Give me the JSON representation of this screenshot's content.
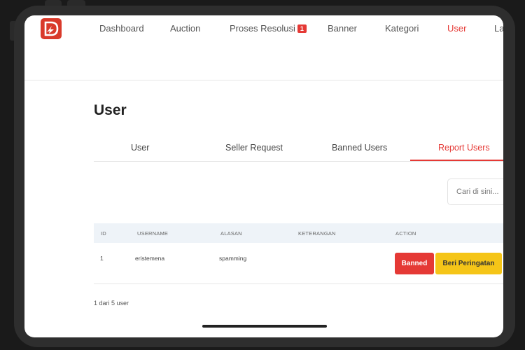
{
  "nav": {
    "items": [
      {
        "label": "Dashboard"
      },
      {
        "label": "Auction"
      },
      {
        "label": "Proses Resolusi",
        "badge": "1"
      },
      {
        "label": "Banner"
      },
      {
        "label": "Kategori"
      },
      {
        "label": "User"
      },
      {
        "label": "La"
      }
    ],
    "active": "User"
  },
  "page": {
    "title": "User"
  },
  "tabs": [
    {
      "label": "User"
    },
    {
      "label": "Seller Request"
    },
    {
      "label": "Banned Users"
    },
    {
      "label": "Report Users"
    }
  ],
  "active_tab": "Report Users",
  "search": {
    "placeholder": "Cari di sini..."
  },
  "table": {
    "headers": [
      "ID",
      "USERNAME",
      "ALASAN",
      "KETERANGAN",
      "ACTION"
    ],
    "rows": [
      {
        "id": "1",
        "username": "eristemena",
        "alasan": "spamming",
        "keterangan": "",
        "actions": {
          "banned": "Banned",
          "warn": "Beri Peringatan"
        }
      }
    ]
  },
  "footer": {
    "count_text": "1 dari 5 user"
  },
  "colors": {
    "accent": "#e53935",
    "warning": "#f5c518",
    "table_header": "#eef3f8"
  }
}
